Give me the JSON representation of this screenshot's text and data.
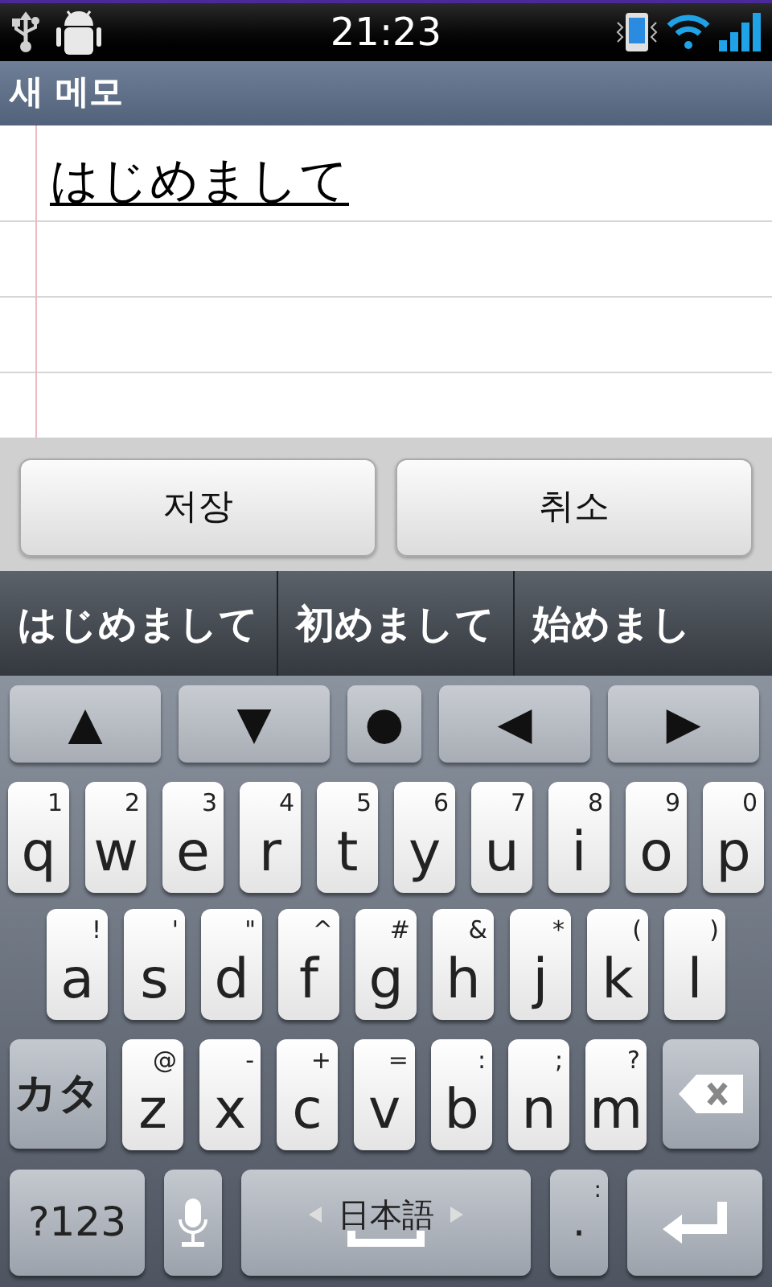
{
  "status_bar": {
    "time": "21:23"
  },
  "title": "새 메모",
  "memo": {
    "text": "はじめまして"
  },
  "buttons": [
    "저장",
    "취소"
  ],
  "candidates": [
    "はじめまして",
    "初めまして",
    "始めまし"
  ],
  "arrow_keys": [
    {
      "label": "▲",
      "kind": "wide"
    },
    {
      "label": "▼",
      "kind": "wide"
    },
    {
      "label": "●",
      "kind": "narrow"
    },
    {
      "label": "◀",
      "kind": "wide"
    },
    {
      "label": "▶",
      "kind": "wide"
    }
  ],
  "keyboard": {
    "letter_row_1": [
      {
        "kind": "letter",
        "label": "q",
        "hint": "1"
      },
      {
        "kind": "letter",
        "label": "w",
        "hint": "2"
      },
      {
        "kind": "letter",
        "label": "e",
        "hint": "3"
      },
      {
        "kind": "letter",
        "label": "r",
        "hint": "4"
      },
      {
        "kind": "letter",
        "label": "t",
        "hint": "5"
      },
      {
        "kind": "letter",
        "label": "y",
        "hint": "6"
      },
      {
        "kind": "letter",
        "label": "u",
        "hint": "7"
      },
      {
        "kind": "letter",
        "label": "i",
        "hint": "8"
      },
      {
        "kind": "letter",
        "label": "o",
        "hint": "9"
      },
      {
        "kind": "letter",
        "label": "p",
        "hint": "0"
      }
    ],
    "letter_row_2": [
      {
        "kind": "letter",
        "label": "a",
        "hint": "!"
      },
      {
        "kind": "letter",
        "label": "s",
        "hint": "'"
      },
      {
        "kind": "letter",
        "label": "d",
        "hint": "\""
      },
      {
        "kind": "letter",
        "label": "f",
        "hint": "^"
      },
      {
        "kind": "letter",
        "label": "g",
        "hint": "#"
      },
      {
        "kind": "letter",
        "label": "h",
        "hint": "&"
      },
      {
        "kind": "letter",
        "label": "j",
        "hint": "*"
      },
      {
        "kind": "letter",
        "label": "k",
        "hint": "("
      },
      {
        "kind": "letter",
        "label": "l",
        "hint": ")"
      }
    ],
    "letter_row_3": [
      {
        "kind": "mode",
        "label": "カタ"
      },
      {
        "kind": "letter",
        "label": "z",
        "hint": "@"
      },
      {
        "kind": "letter",
        "label": "x",
        "hint": "-"
      },
      {
        "kind": "letter",
        "label": "c",
        "hint": "+"
      },
      {
        "kind": "letter",
        "label": "v",
        "hint": "="
      },
      {
        "kind": "letter",
        "label": "b",
        "hint": ":"
      },
      {
        "kind": "letter",
        "label": "n",
        "hint": ";"
      },
      {
        "kind": "letter",
        "label": "m",
        "hint": "?"
      },
      {
        "kind": "backspace"
      }
    ],
    "bottom_row": [
      {
        "kind": "symbols",
        "label": "?123"
      },
      {
        "kind": "mic"
      },
      {
        "kind": "space",
        "label": "日本語"
      },
      {
        "kind": "punct",
        "label": ".",
        "hint": ":"
      },
      {
        "kind": "enter"
      }
    ]
  }
}
